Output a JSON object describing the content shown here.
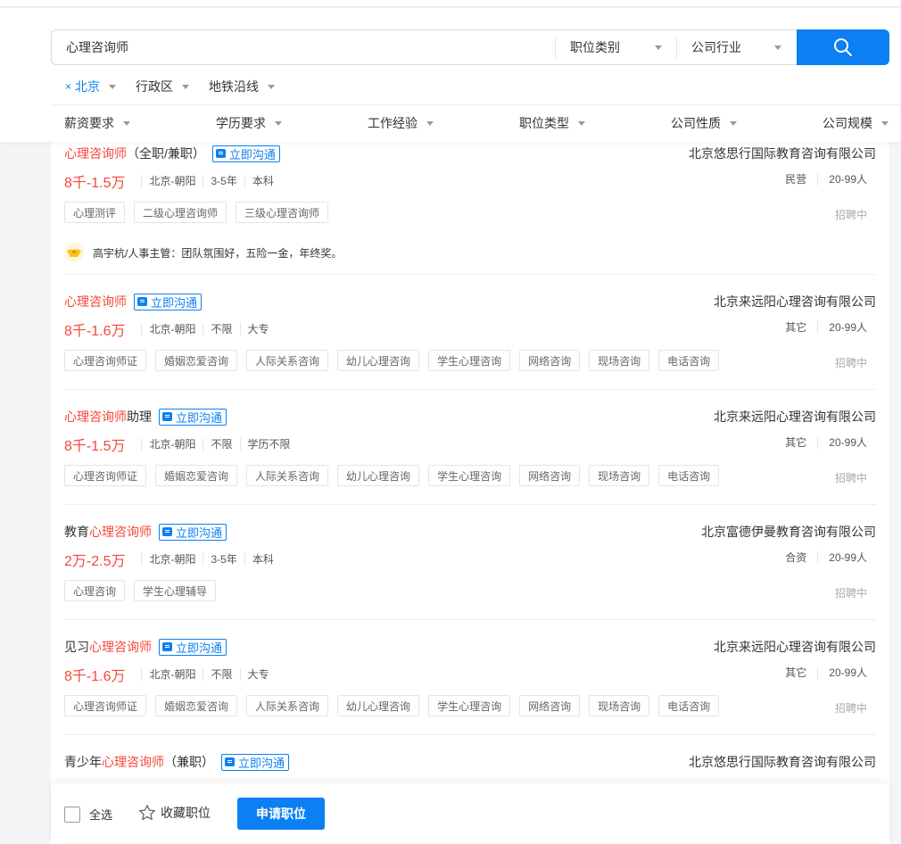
{
  "search": {
    "query": "心理咨询师",
    "job_category": "职位类别",
    "industry": "公司行业"
  },
  "city_filters": [
    {
      "label": "北京",
      "active": true,
      "removable": "×"
    },
    {
      "label": "行政区",
      "active": false
    },
    {
      "label": "地铁沿线",
      "active": false
    }
  ],
  "filters": [
    "薪资要求",
    "学历要求",
    "工作经验",
    "职位类型",
    "公司性质",
    "公司规模"
  ],
  "jobs": [
    {
      "title_pre": "",
      "title_hl": "心理咨询师",
      "title_post": "（全职/兼职）",
      "chat": "立即沟通",
      "company": "北京悠思行国际教育咨询有限公司",
      "salary": "8千-1.5万",
      "location": "北京-朝阳",
      "experience": "3-5年",
      "education": "本科",
      "company_type": "民营",
      "company_size": "20-99人",
      "tags": [
        "心理测评",
        "二级心理咨询师",
        "三级心理咨询师"
      ],
      "status": "招聘中",
      "hr_note": "高宇杭/人事主管：团队氛围好，五险一金，年终奖。"
    },
    {
      "title_pre": "",
      "title_hl": "心理咨询师",
      "title_post": "",
      "chat": "立即沟通",
      "company": "北京来远阳心理咨询有限公司",
      "salary": "8千-1.6万",
      "location": "北京-朝阳",
      "experience": "不限",
      "education": "大专",
      "company_type": "其它",
      "company_size": "20-99人",
      "tags": [
        "心理咨询师证",
        "婚姻恋爱咨询",
        "人际关系咨询",
        "幼儿心理咨询",
        "学生心理咨询",
        "网络咨询",
        "现场咨询",
        "电话咨询"
      ],
      "status": "招聘中"
    },
    {
      "title_pre": "",
      "title_hl": "心理咨询师",
      "title_post": "助理",
      "chat": "立即沟通",
      "company": "北京来远阳心理咨询有限公司",
      "salary": "8千-1.5万",
      "location": "北京-朝阳",
      "experience": "不限",
      "education": "学历不限",
      "company_type": "其它",
      "company_size": "20-99人",
      "tags": [
        "心理咨询师证",
        "婚姻恋爱咨询",
        "人际关系咨询",
        "幼儿心理咨询",
        "学生心理咨询",
        "网络咨询",
        "现场咨询",
        "电话咨询"
      ],
      "status": "招聘中"
    },
    {
      "title_pre": "教育",
      "title_hl": "心理咨询师",
      "title_post": "",
      "chat": "立即沟通",
      "company": "北京富德伊曼教育咨询有限公司",
      "salary": "2万-2.5万",
      "location": "北京-朝阳",
      "experience": "3-5年",
      "education": "本科",
      "company_type": "合资",
      "company_size": "20-99人",
      "tags": [
        "心理咨询",
        "学生心理辅导"
      ],
      "status": "招聘中"
    },
    {
      "title_pre": "见习",
      "title_hl": "心理咨询师",
      "title_post": "",
      "chat": "立即沟通",
      "company": "北京来远阳心理咨询有限公司",
      "salary": "8千-1.6万",
      "location": "北京-朝阳",
      "experience": "不限",
      "education": "大专",
      "company_type": "其它",
      "company_size": "20-99人",
      "tags": [
        "心理咨询师证",
        "婚姻恋爱咨询",
        "人际关系咨询",
        "幼儿心理咨询",
        "学生心理咨询",
        "网络咨询",
        "现场咨询",
        "电话咨询"
      ],
      "status": "招聘中"
    },
    {
      "title_pre": "青少年",
      "title_hl": "心理咨询师",
      "title_post": "（兼职）",
      "chat": "立即沟通",
      "company": "北京悠思行国际教育咨询有限公司"
    }
  ],
  "bottom_bar": {
    "select_all": "全选",
    "favorite": "收藏职位",
    "apply": "申请职位"
  },
  "colors": {
    "accent": "#0c7ff2",
    "highlight": "#f5473a"
  }
}
